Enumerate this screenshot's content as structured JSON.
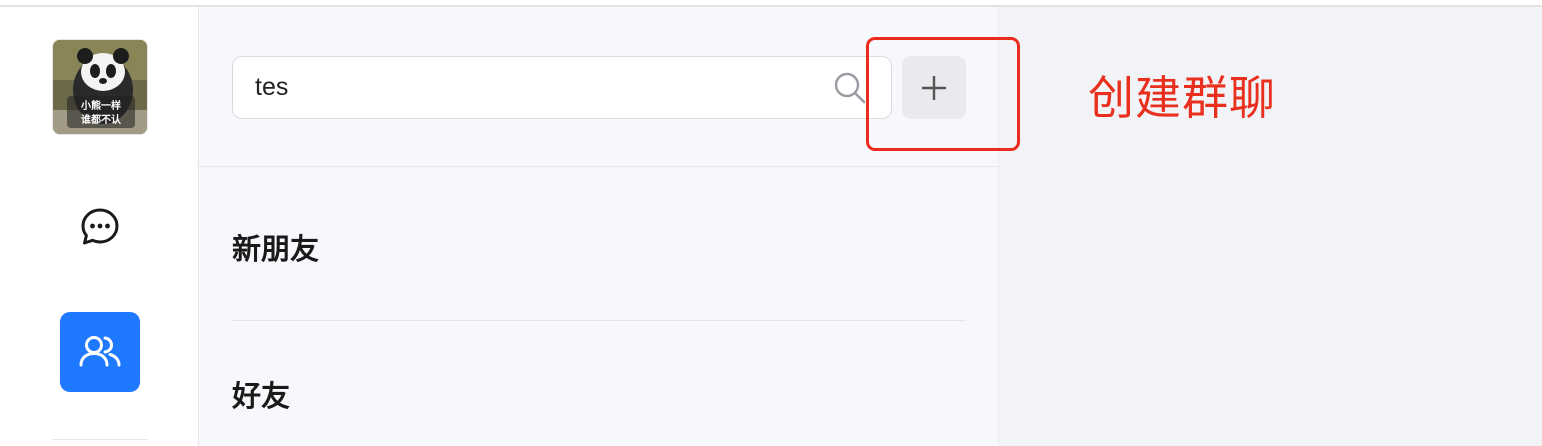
{
  "search": {
    "value": "tes"
  },
  "sidebar": {
    "items": [
      {
        "name": "avatar",
        "icon": "panda-avatar",
        "text_lines": [
          "小熊一样",
          "谁都不认"
        ]
      },
      {
        "name": "chat",
        "icon": "chat-bubble-icon"
      },
      {
        "name": "contacts",
        "icon": "contacts-icon",
        "active": true
      }
    ]
  },
  "list": {
    "sections": [
      {
        "label": "新朋友"
      },
      {
        "label": "好友"
      }
    ]
  },
  "annotation": {
    "label": "创建群聊",
    "color": "#ec2b1f"
  },
  "colors": {
    "accent": "#1f79ff",
    "panel_bg": "#f7f8fb",
    "content_bg": "#f2f3f6"
  }
}
